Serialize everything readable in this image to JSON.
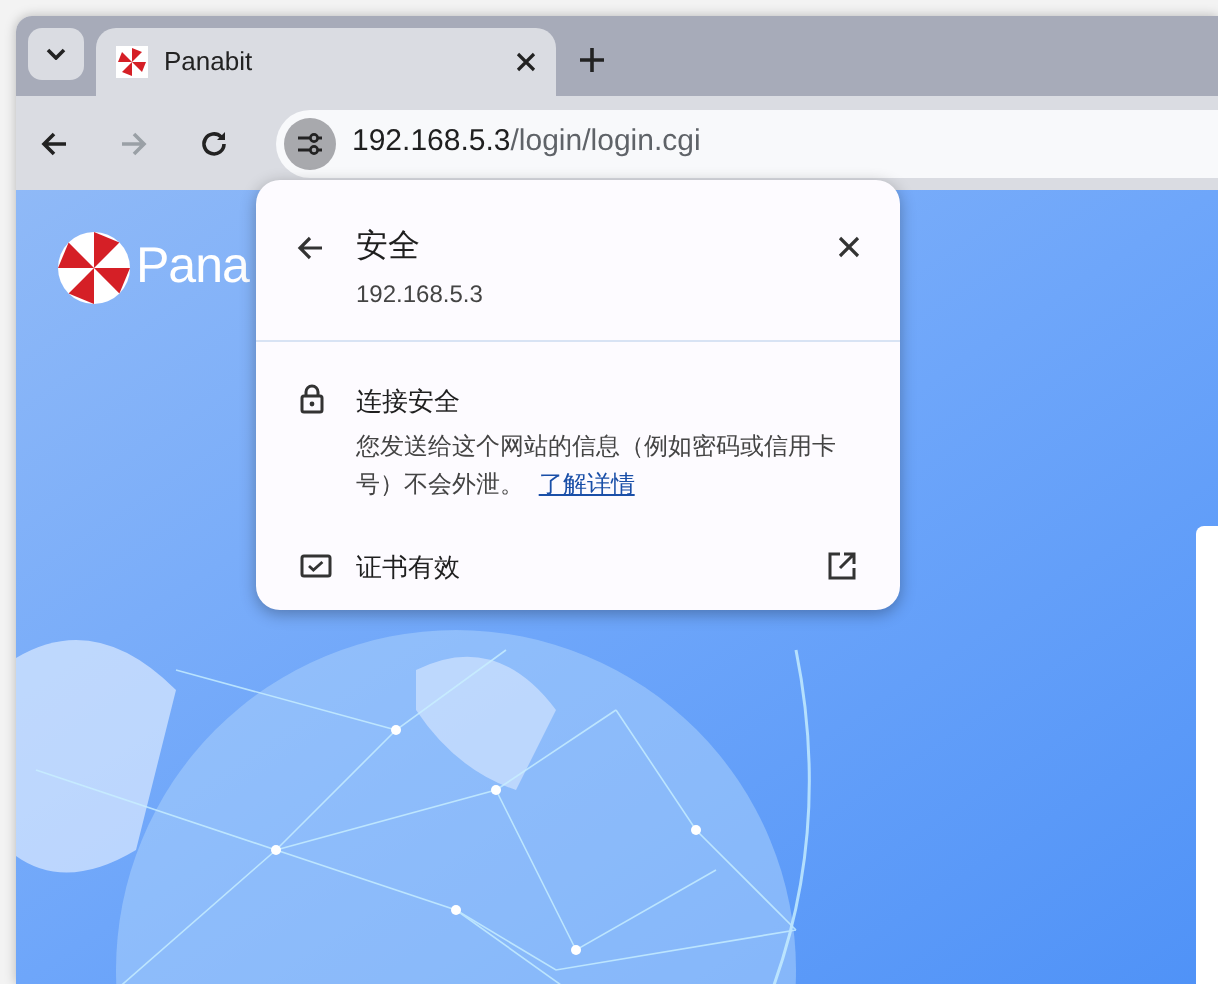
{
  "tab": {
    "title": "Panabit",
    "selected": true
  },
  "toolbar": {
    "url_host": "192.168.5.3",
    "url_path": "/login/login.cgi",
    "forward_disabled": true
  },
  "popup": {
    "title": "安全",
    "host": "192.168.5.3",
    "connection": {
      "heading": "连接安全",
      "description": "您发送给这个网站的信息（例如密码或信用卡号）不会外泄。",
      "link": "了解详情"
    },
    "certificate": {
      "label": "证书有效"
    }
  },
  "page": {
    "logo_text": "Pana"
  }
}
